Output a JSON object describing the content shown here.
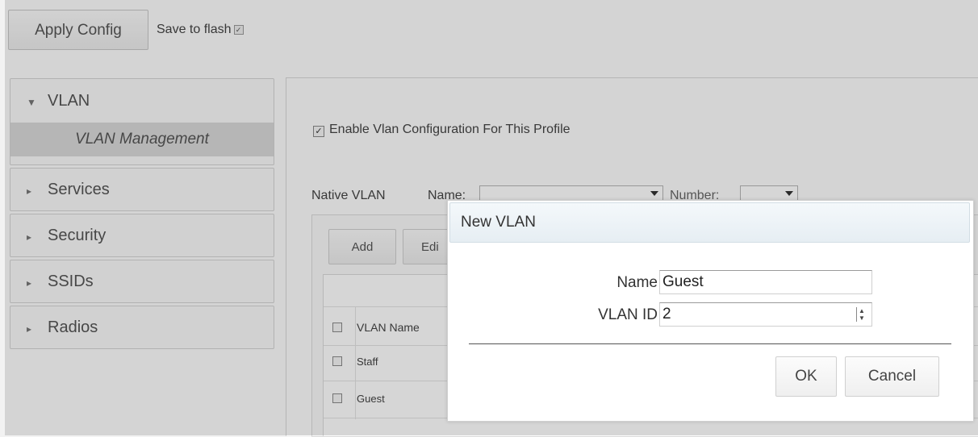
{
  "toolbar": {
    "apply_label": "Apply Config",
    "save_label": "Save to flash"
  },
  "nav": {
    "vlan": {
      "label": "VLAN",
      "sub": "VLAN Management"
    },
    "items": [
      {
        "label": "Services"
      },
      {
        "label": "Security"
      },
      {
        "label": "SSIDs"
      },
      {
        "label": "Radios"
      }
    ]
  },
  "content": {
    "enable_label": "Enable Vlan Configuration For This Profile",
    "native_label": "Native VLAN",
    "name_label": "Name:",
    "number_label": "Number:",
    "add_label": "Add",
    "edit_label": "Edi",
    "col_vlan_name": "VLAN Name",
    "rows": [
      "Staff",
      "Guest"
    ]
  },
  "dialog": {
    "title": "New VLAN",
    "name_label": "Name",
    "name_value": "Guest",
    "vlanid_label": "VLAN ID",
    "vlanid_value": "2",
    "ok_label": "OK",
    "cancel_label": "Cancel"
  }
}
